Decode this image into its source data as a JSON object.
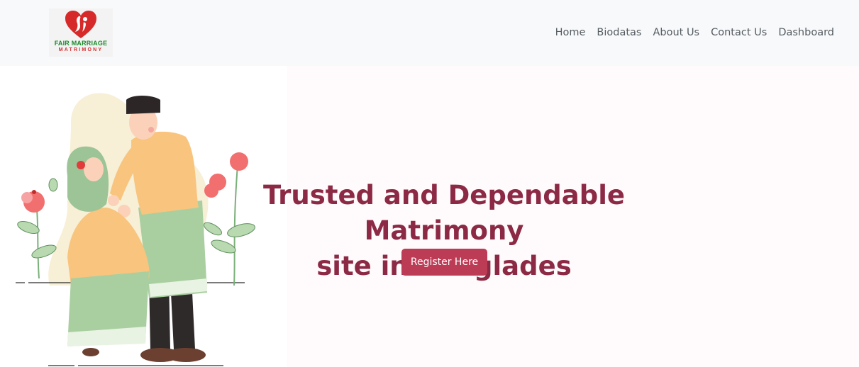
{
  "brand": {
    "logo_line1": "FAIR MARRIAGE",
    "logo_line2": "MATRIMONY",
    "heart_color": "#d62a2a",
    "text_green": "#1a8a2a"
  },
  "nav": {
    "items": [
      {
        "label": "Home"
      },
      {
        "label": "Biodatas"
      },
      {
        "label": "About Us"
      },
      {
        "label": "Contact Us"
      },
      {
        "label": "Dashboard"
      }
    ]
  },
  "hero": {
    "title_line1": "Trusted and Dependable Matrimony",
    "title_line2": "site in Banglades",
    "register_label": "Register Here",
    "title_color": "#8c2a45",
    "button_color": "#bc3b55",
    "illustration": "couple-illustration"
  }
}
